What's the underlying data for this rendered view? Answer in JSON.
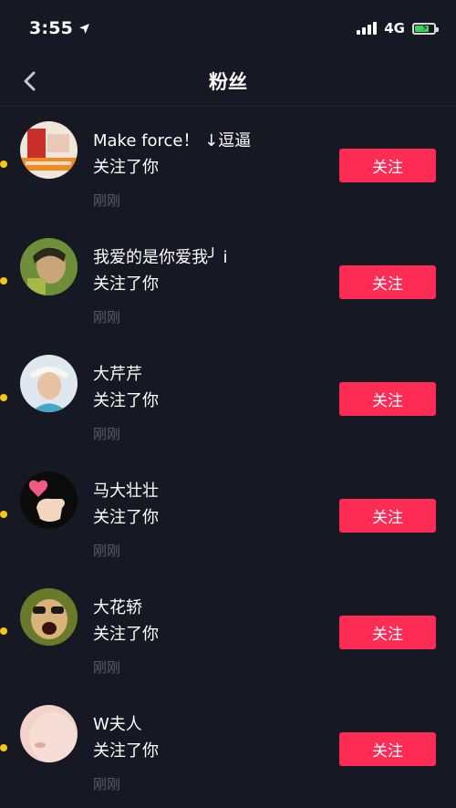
{
  "status_bar": {
    "time": "3:55",
    "network": "4G"
  },
  "nav": {
    "title": "粉丝"
  },
  "followers": [
    {
      "name": "Make force！ ↓逗逼",
      "action": "关注了你",
      "time": "刚刚",
      "follow_label": "关注"
    },
    {
      "name": "我爱的是你爱我╯ i",
      "action": "关注了你",
      "time": "刚刚",
      "follow_label": "关注"
    },
    {
      "name": "大芹芹",
      "action": "关注了你",
      "time": "刚刚",
      "follow_label": "关注"
    },
    {
      "name": "马大壮壮",
      "action": "关注了你",
      "time": "刚刚",
      "follow_label": "关注"
    },
    {
      "name": "大花轿",
      "action": "关注了你",
      "time": "刚刚",
      "follow_label": "关注"
    },
    {
      "name": "W夫人",
      "action": "关注了你",
      "time": "刚刚",
      "follow_label": "关注"
    }
  ],
  "colors": {
    "background": "#161823",
    "accent": "#fe2c55",
    "unread_dot": "#f5c518"
  }
}
